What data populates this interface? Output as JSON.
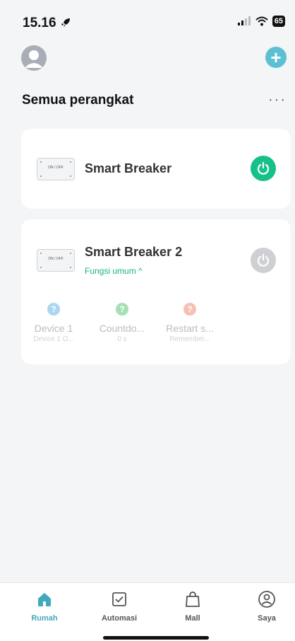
{
  "status_bar": {
    "time": "15.16",
    "battery": "65"
  },
  "header": {
    "add_label": "+",
    "more_label": "···"
  },
  "section": {
    "title": "Semua perangkat"
  },
  "devices": [
    {
      "name": "Smart Breaker",
      "thumb_label": "ON / OFF",
      "power": "on"
    },
    {
      "name": "Smart Breaker 2",
      "thumb_label": "ON / OFF",
      "power": "off",
      "functions_link": "Fungsi umum ^",
      "functions": [
        {
          "title": "Device 1",
          "subtitle": "Device 1 O...",
          "icon": "question-icon",
          "color": "#a9d7f2"
        },
        {
          "title": "Countdo...",
          "subtitle": "0 s",
          "icon": "question-icon",
          "color": "#a7e0b4"
        },
        {
          "title": "Restart s...",
          "subtitle": "Remember...",
          "icon": "question-icon",
          "color": "#f6c0b4"
        }
      ]
    }
  ],
  "tabs": [
    {
      "label": "Rumah",
      "icon": "home-icon",
      "active": true
    },
    {
      "label": "Automasi",
      "icon": "checkbox-icon",
      "active": false
    },
    {
      "label": "Mall",
      "icon": "shopping-bag-icon",
      "active": false
    },
    {
      "label": "Saya",
      "icon": "user-icon",
      "active": false
    }
  ],
  "colors": {
    "accent": "#41a9bd",
    "power_on": "#17c08a",
    "power_off": "#cfd0d3",
    "add_button": "#5bc1d2"
  }
}
